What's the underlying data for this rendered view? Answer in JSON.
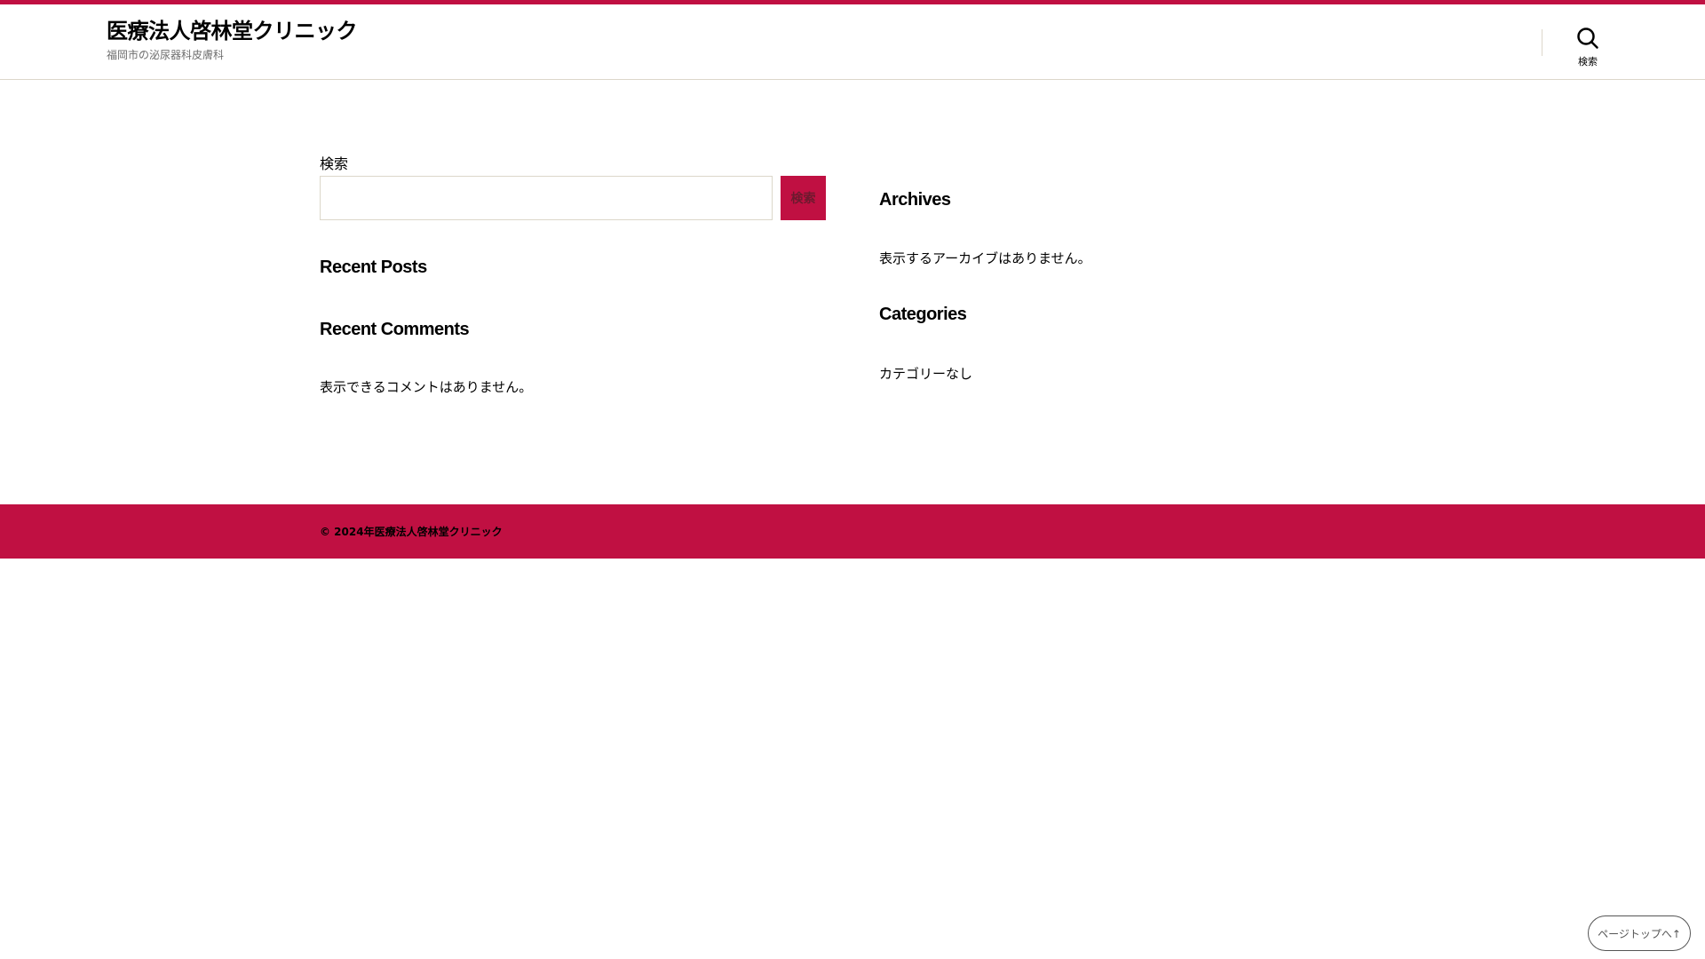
{
  "colors": {
    "accent": "#c01042",
    "border": "#dcd7ca"
  },
  "header": {
    "site_title": "医療法人啓林堂クリニック",
    "site_description": "福岡市の泌尿器科皮膚科",
    "search_toggle_label": "検索",
    "search_toggle_icon": "search-icon"
  },
  "search_widget": {
    "label": "検索",
    "input_value": "",
    "button_label": "検索"
  },
  "recent_posts": {
    "title": "Recent Posts"
  },
  "recent_comments": {
    "title": "Recent Comments",
    "empty_text": "表示できるコメントはありません。"
  },
  "archives": {
    "title": "Archives",
    "empty_text": "表示するアーカイブはありません。"
  },
  "categories": {
    "title": "Categories",
    "empty_text": "カテゴリーなし"
  },
  "footer": {
    "copyright": "© 2024年医療法人啓林堂クリニック"
  },
  "page_top": {
    "label": "ページトップへ↑"
  }
}
